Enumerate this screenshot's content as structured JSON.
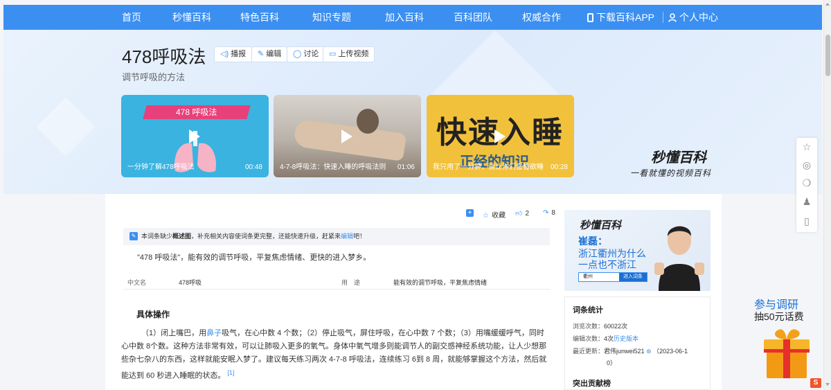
{
  "nav": {
    "items": [
      "首页",
      "秒懂百科",
      "特色百科",
      "知识专题",
      "加入百科",
      "百科团队",
      "权威合作"
    ],
    "download": "下载百科APP",
    "user": "个人中心"
  },
  "header": {
    "title": "478呼吸法",
    "subtitle": "调节呼吸的方法",
    "tools": [
      "播报",
      "编辑",
      "讨论",
      "上传视频"
    ]
  },
  "videos": [
    {
      "banner": "478 呼吸法",
      "caption": "一分钟了解478呼吸法",
      "duration": "00:48"
    },
    {
      "caption": "4-7-8呼吸法：快速入睡的呼吸法则",
      "duration": "01:06"
    },
    {
      "title": "快速入睡",
      "subtitle": "正经的知识",
      "caption": "我只用了一分钟，就让你们昏昏欲睡",
      "duration": "00:28"
    }
  ],
  "brand": {
    "logo": "秒懂百科",
    "slogan": "一看就懂的视频百科"
  },
  "actions": {
    "favorite": "收藏",
    "likes": "2",
    "shares": "8"
  },
  "notice": {
    "prefix": "本词条缺少",
    "bold": "概述图",
    "middle": "，补充相关内容使词条更完整，还能快速升级，赶紧来",
    "link": "编辑",
    "suffix": "吧！"
  },
  "summary": "\"478 呼吸法\"，能有效的调节呼吸，平复焦虑情绪、更快的进入梦乡。",
  "infobox": {
    "k1": "中文名",
    "v1": "478呼吸",
    "k2": "用　途",
    "v2": "能有效的调节呼吸，平复焦虑情绪"
  },
  "section": {
    "heading": "具体操作",
    "p_a": "（1）闭上嘴巴，用",
    "p_link": "鼻子",
    "p_b": "吸气，在心中数 4 个数；（2）停止吸气，屏住呼吸，在心中数 7 个数；（3）用嘴缓缓呼气，同时心中数 8个数。这种方法非常有效，可以让肺吸入更多的氧气。身体中氧气增多则能调节人的副交感神经系统功能，让人少想那些杂七杂八的东西，这样就能安眠入梦了。建议每天练习两次 4-7-8 呼吸法，连续练习 6到 8 周，就能够掌握这个方法，然后就能达到 60 秒进入睡眠的状态。",
    "ref": "[1]"
  },
  "ad": {
    "logo": "秒懂百科",
    "line1": "崔磊：",
    "line2": "浙江衢州为什么",
    "line3": "一点也不浙江",
    "chip_a": "衢州",
    "chip_b": "进入词条"
  },
  "stats": {
    "heading": "词条统计",
    "views_label": "浏览次数：",
    "views": "60022次",
    "edits_label": "编辑次数：",
    "edits": "4次",
    "history": "历史版本",
    "updated_label": "最近更新：",
    "updated_by": "君伟junwei521",
    "updated_date_a": "（2023-06-1",
    "updated_date_b": "0）",
    "contrib_heading": "突出贡献榜"
  },
  "survey": {
    "line1": "参与调研",
    "line2": "抽50元话费"
  },
  "colors": {
    "nav": "#3b8ff1",
    "link": "#3b8ff1",
    "accent": "#1a6fd1"
  },
  "icons": [
    "star-icon",
    "weibo-icon",
    "wechat-icon",
    "qq-icon",
    "mobile-icon"
  ]
}
